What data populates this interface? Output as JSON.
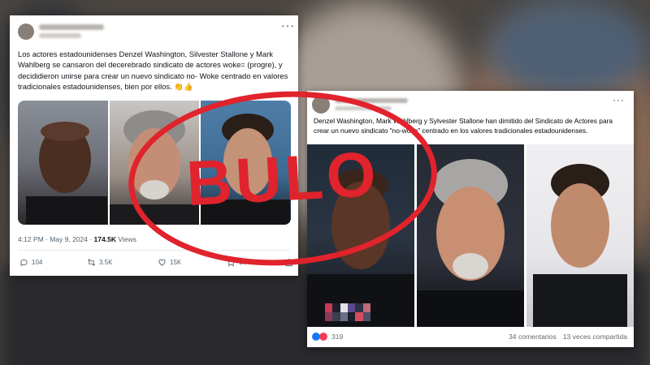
{
  "tweet": {
    "text": "Los actores estadounidenses Denzel Washington, Silvester Stallone y Mark Wahlberg se cansaron del decerebrado sindicato de actores woke= (progre), y decididieron unirse para crear un nuevo sindicato no- Woke centrado en valores tradicionales estadounidenses, bien por ellos. 👏👍",
    "time": "4:12 PM · May 9, 2024 · ",
    "views_count": "174.5K",
    "views_label": " Views",
    "replies": "104",
    "retweets": "3.5K",
    "likes": "15K",
    "bookmarks": "164"
  },
  "fbpost": {
    "text": "Denzel Washington, Mark Wahlberg y Sylvester Stallone han dimitido del Sindicato de Actores para crear un nuevo sindicato \"no-woke\" centrado en los valores tradicionales estadounidenses.",
    "reactions": "319",
    "comments": "34 comentarios",
    "shares": "13 veces compartida"
  },
  "stamp": {
    "label": "BULO",
    "color": "#e0232c"
  },
  "icons": {
    "more": "more-options-icon",
    "reply": "reply-icon",
    "retweet": "retweet-icon",
    "like": "heart-icon",
    "bookmark": "bookmark-icon"
  }
}
